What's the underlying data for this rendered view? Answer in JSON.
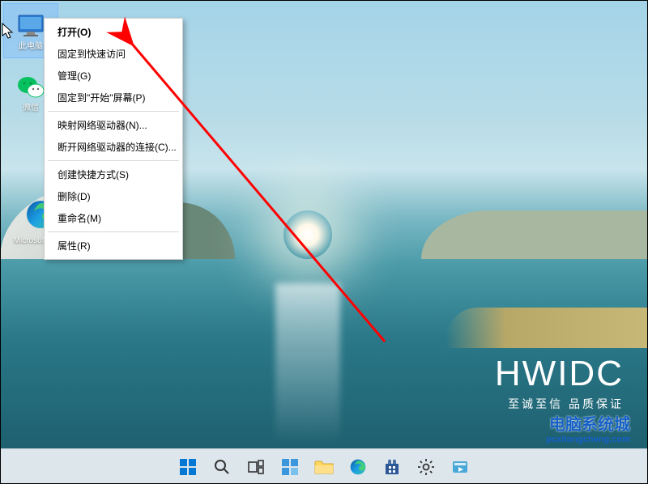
{
  "desktop_icons": {
    "this_pc": "此电脑",
    "wechat": "微信",
    "edge": "Microsoft Edge"
  },
  "context_menu": {
    "open": "打开(O)",
    "pin_quick_access": "固定到快速访问",
    "manage": "管理(G)",
    "pin_start": "固定到\"开始\"屏幕(P)",
    "map_drive": "映射网络驱动器(N)...",
    "disconnect_drive": "断开网络驱动器的连接(C)...",
    "create_shortcut": "创建快捷方式(S)",
    "delete": "删除(D)",
    "rename": "重命名(M)",
    "properties": "属性(R)"
  },
  "watermark1": {
    "title": "HWIDC",
    "subtitle": "至诚至信 品质保证"
  },
  "watermark2": {
    "line1": "电脑系统城",
    "line2": "pcxitongcheng.com"
  },
  "taskbar": {
    "start": "start",
    "search": "search",
    "task_view": "task-view",
    "widgets": "widgets",
    "explorer": "file-explorer",
    "edge": "edge",
    "store": "microsoft-store",
    "settings": "settings",
    "app": "media-app"
  }
}
